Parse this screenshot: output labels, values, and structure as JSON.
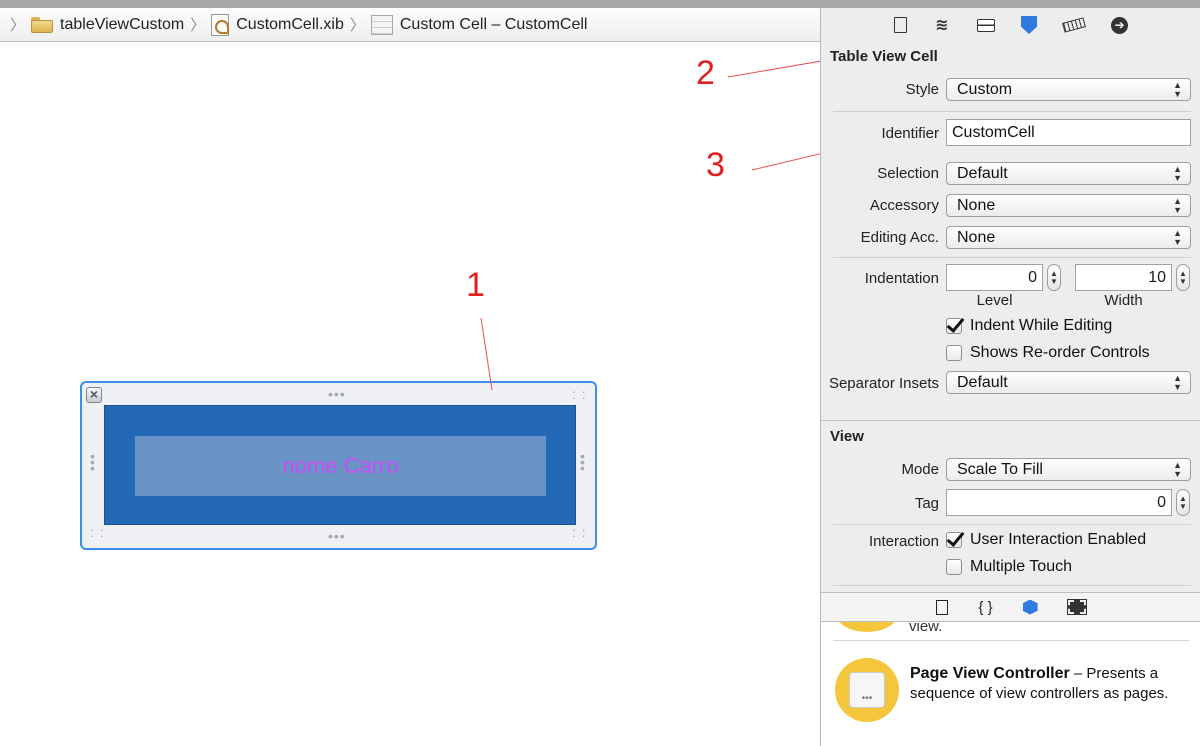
{
  "breadcrumb": [
    {
      "label": "tableViewCustom",
      "icon": "folder-icon"
    },
    {
      "label": "CustomCell.xib",
      "icon": "xib-file-icon"
    },
    {
      "label": "Custom Cell – CustomCell",
      "icon": "table-cell-icon"
    }
  ],
  "annotations": {
    "one": "1",
    "two": "2",
    "three": "3"
  },
  "canvas": {
    "cell_label_text": "nome Carro"
  },
  "inspector": {
    "tabs": [
      "file-inspector-icon",
      "quick-help-icon",
      "identity-inspector-icon",
      "attributes-inspector-icon",
      "size-inspector-icon",
      "connections-inspector-icon"
    ],
    "table_view_cell": {
      "title": "Table View Cell",
      "style_label": "Style",
      "style_value": "Custom",
      "identifier_label": "Identifier",
      "identifier_value": "CustomCell",
      "selection_label": "Selection",
      "selection_value": "Default",
      "accessory_label": "Accessory",
      "accessory_value": "None",
      "editing_acc_label": "Editing Acc.",
      "editing_acc_value": "None",
      "indentation_label": "Indentation",
      "level_value": "0",
      "width_value": "10",
      "level_sub": "Level",
      "width_sub": "Width",
      "indent_while_editing": "Indent While Editing",
      "shows_reorder": "Shows Re-order Controls",
      "separator_label": "Separator Insets",
      "separator_value": "Default"
    },
    "view": {
      "title": "View",
      "mode_label": "Mode",
      "mode_value": "Scale To Fill",
      "tag_label": "Tag",
      "tag_value": "0",
      "interaction_label": "Interaction",
      "user_interaction": "User Interaction Enabled",
      "multiple_touch": "Multiple Touch"
    },
    "library_tabs": [
      "file-template-icon",
      "code-snippet-icon",
      "object-library-icon",
      "media-library-icon"
    ],
    "library": {
      "partial_text": "view.",
      "item_title": "Page View Controller",
      "item_desc": " – Presents a sequence of view controllers as pages."
    }
  }
}
